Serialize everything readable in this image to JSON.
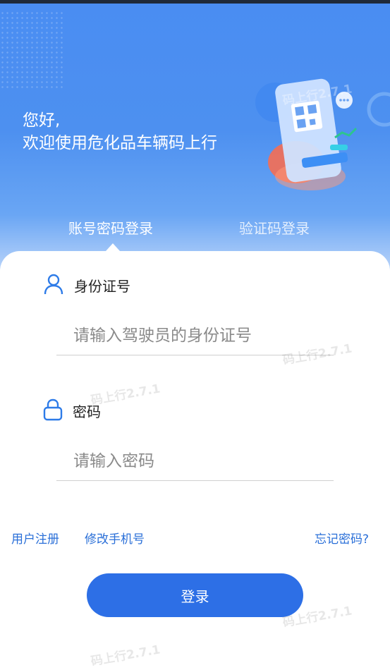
{
  "greeting": {
    "line1": "您好,",
    "line2": "欢迎使用危化品车辆码上行"
  },
  "tabs": [
    {
      "label": "账号密码登录",
      "active": true
    },
    {
      "label": "验证码登录",
      "active": false
    }
  ],
  "form": {
    "id_label": "身份证号",
    "id_placeholder": "请输入驾驶员的身份证号",
    "password_label": "密码",
    "password_placeholder": "请输入密码"
  },
  "links": {
    "register": "用户注册",
    "change_phone": "修改手机号",
    "forgot_password": "忘记密码?"
  },
  "login_button": "登录",
  "watermark": "码上行2.7.1",
  "colors": {
    "primary": "#2d6fe6",
    "link": "#2a6fd8",
    "hero_top": "#4a8df2"
  }
}
